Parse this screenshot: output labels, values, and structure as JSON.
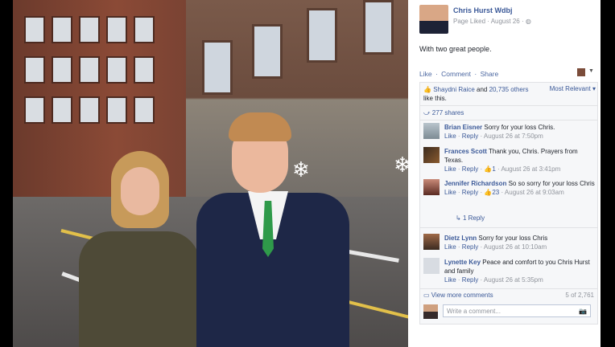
{
  "post": {
    "author": "Chris Hurst Wdbj",
    "subline": "Page Liked · August 26 · ",
    "globe_icon": "globe-icon",
    "text_prefix": "With ",
    "text_tag": "two great people",
    "text_suffix": "."
  },
  "actions": {
    "like": "Like",
    "sep1": " · ",
    "comment": "Comment",
    "sep2": " · ",
    "share": "Share"
  },
  "likes": {
    "names": "Shaydni Raice",
    "and": " and ",
    "others": "20,735 others",
    "tail": "like this.",
    "sort": "Most Relevant",
    "shares": "277 shares"
  },
  "comments": [
    {
      "name": "Brian Eisner",
      "text": "Sorry for your loss Chris.",
      "like": "Like",
      "reply": "Reply",
      "count": "",
      "time": "August 26 at 7:50pm"
    },
    {
      "name": "Frances Scott",
      "text": "Thank you, Chris. Prayers from Texas.",
      "like": "Like",
      "reply": "Reply",
      "count": "1",
      "time": "August 26 at 3:41pm"
    },
    {
      "name": "Jennifer Richardson",
      "text": "So so sorry for your loss Chris",
      "like": "Like",
      "reply": "Reply",
      "count": "23",
      "time": "August 26 at 9:03am"
    },
    {
      "name": "Dietz Lynn",
      "text": "Sorry for your loss Chris",
      "like": "Like",
      "reply": "Reply",
      "count": "",
      "time": "August 26 at 10:10am"
    },
    {
      "name": "Lynette Key",
      "text": "Peace and comfort to you Chris Hurst and family",
      "like": "Like",
      "reply": "Reply",
      "count": "",
      "time": "August 26 at 5:35pm"
    }
  ],
  "one_reply": "1 Reply",
  "footer": {
    "view_more": "View more comments",
    "count": "5 of 2,761",
    "write_placeholder": "Write a comment..."
  },
  "colors": {
    "fb_blue": "#3b5998",
    "meta_gray": "#90949c"
  }
}
